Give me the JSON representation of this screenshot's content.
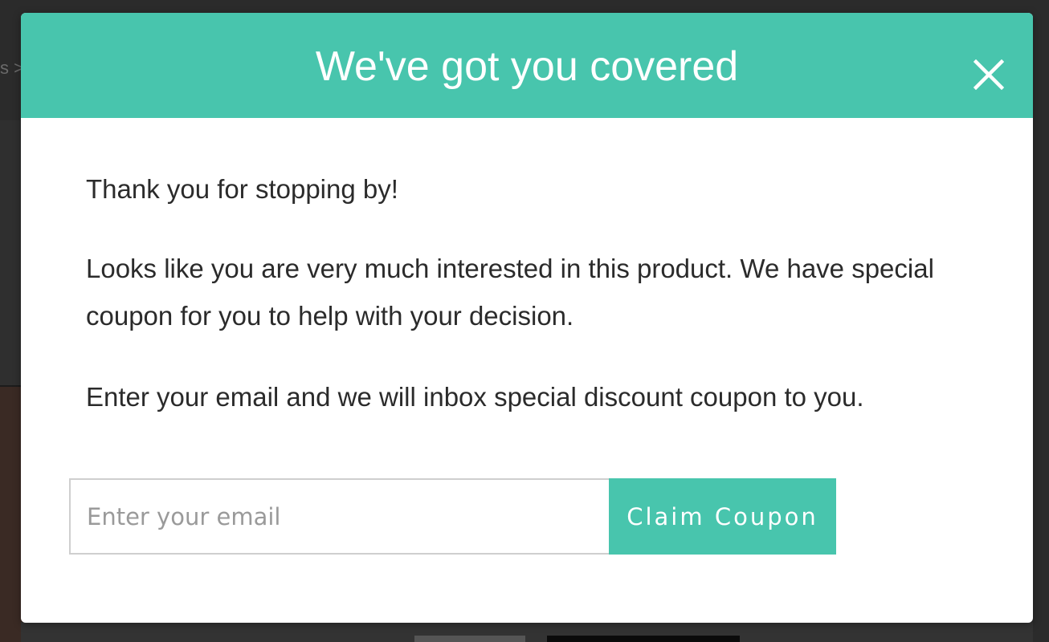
{
  "background": {
    "breadcrumb_fragment": "s >"
  },
  "modal": {
    "title": "We've got you covered",
    "close_icon": "close-icon",
    "paragraphs": [
      "Thank you for stopping by!",
      "Looks like you are very much interested in this product. We have special coupon for you to help with your decision.",
      "Enter your email and we will inbox special discount coupon to you."
    ],
    "email_input": {
      "value": "",
      "placeholder": "Enter your email"
    },
    "claim_button_label": "Claim Coupon"
  },
  "colors": {
    "accent": "#48c5ad",
    "text": "#2b2b2b",
    "overlay": "#2b2b2b"
  }
}
